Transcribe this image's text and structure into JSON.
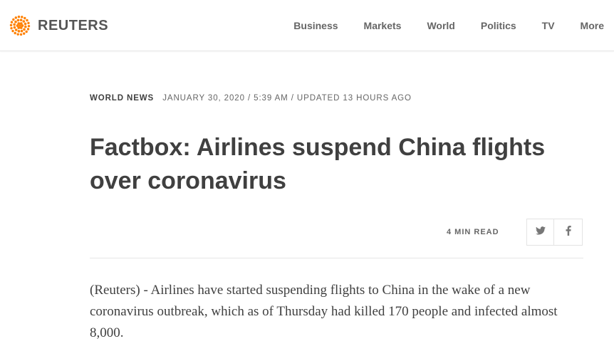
{
  "header": {
    "brand": "REUTERS",
    "logo_icon": "reuters-dot-logo-icon",
    "brand_color": "#ff8000",
    "nav": [
      {
        "label": "Business"
      },
      {
        "label": "Markets"
      },
      {
        "label": "World"
      },
      {
        "label": "Politics"
      },
      {
        "label": "TV"
      },
      {
        "label": "More"
      }
    ]
  },
  "article": {
    "section": "WORLD NEWS",
    "dateline": "JANUARY 30, 2020 / 5:39 AM / UPDATED 13 HOURS AGO",
    "headline": "Factbox: Airlines suspend China flights over coronavirus",
    "read_time": "4 MIN READ",
    "share": [
      {
        "icon": "twitter-icon"
      },
      {
        "icon": "facebook-icon"
      }
    ],
    "body": "(Reuters) - Airlines have started suspending flights to China in the wake of a new coronavirus outbreak, which as of Thursday had killed 170 people and infected almost 8,000."
  }
}
